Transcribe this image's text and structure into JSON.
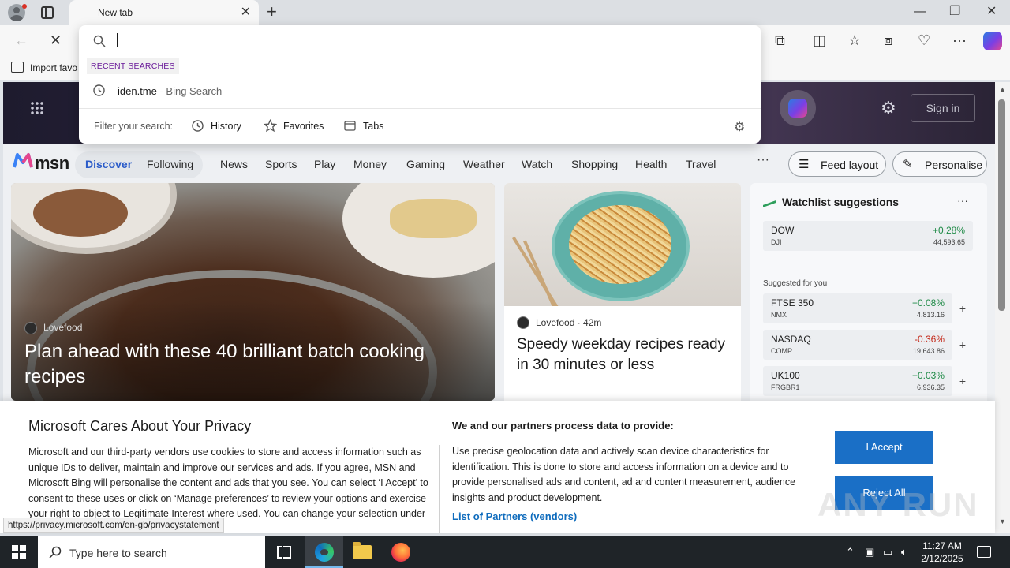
{
  "browser": {
    "tab_title": "New tab",
    "favorites_bar_label": "Import favo"
  },
  "address_dropdown": {
    "input_value": "",
    "recent_label": "RECENT SEARCHES",
    "recent_items": [
      {
        "query": "iden.tme",
        "source": " - Bing Search"
      }
    ],
    "filter_label": "Filter your search:",
    "filters": [
      "History",
      "Favorites",
      "Tabs"
    ]
  },
  "msn": {
    "logo_text": "msn",
    "sign_in": "Sign in",
    "nav": {
      "active": "Discover",
      "items": [
        "Discover",
        "Following",
        "News",
        "Sports",
        "Play",
        "Money",
        "Gaming",
        "Weather",
        "Watch",
        "Shopping",
        "Health",
        "Travel"
      ],
      "more": "···",
      "feed_layout": "Feed layout",
      "personalise": "Personalise"
    },
    "main_card": {
      "source": "Lovefood",
      "title": "Plan ahead with these 40 brilliant batch cooking recipes"
    },
    "side_card": {
      "source": "Lovefood",
      "age": " · 42m",
      "title": "Speedy weekday recipes ready in 30 minutes or less"
    },
    "watchlist": {
      "title": "Watchlist suggestions",
      "more": "···",
      "pinned": [
        {
          "name": "DOW",
          "exchange": "DJI",
          "change": "+0.28%",
          "value": "44,593.65",
          "direction": "up"
        }
      ],
      "suggested_label": "Suggested for you",
      "suggested": [
        {
          "name": "FTSE 350",
          "exchange": "NMX",
          "change": "+0.08%",
          "value": "4,813.16",
          "direction": "up"
        },
        {
          "name": "NASDAQ",
          "exchange": "COMP",
          "change": "-0.36%",
          "value": "19,643.86",
          "direction": "down"
        },
        {
          "name": "UK100",
          "exchange": "FRGBR1",
          "change": "+0.03%",
          "value": "6,936.35",
          "direction": "up"
        }
      ]
    }
  },
  "privacy": {
    "title": "Microsoft Cares About Your Privacy",
    "body": "Microsoft and our third-party vendors use cookies to store and access information such as unique IDs to deliver, maintain and improve our services and ads. If you agree, MSN and Microsoft Bing will personalise the content and ads that you see. You can select ‘I Accept’ to consent to these uses or click on ‘Manage preferences’ to review your options and exercise your right to object to Legitimate Interest where used. You can change your selection under ‘Manage Preferences’ at the bottom of",
    "subtitle": "We and our partners process data to provide:",
    "body2": "Use precise geolocation data and actively scan device characteristics for identification. This is done to store and access information on a device and to provide personalised ads and content, ad and content measurement, audience insights and product development.",
    "partners_link": "List of Partners (vendors)",
    "accept": "I Accept",
    "reject": "Reject All"
  },
  "status_url": "https://privacy.microsoft.com/en-gb/privacystatement",
  "watermark": "ANY RUN",
  "taskbar": {
    "search_placeholder": "Type here to search",
    "time": "11:27 AM",
    "date": "2/12/2025"
  },
  "colors": {
    "accent": "#1a6fc6",
    "link": "#0f6cbd",
    "up": "#1e8a46",
    "down": "#c42b1c",
    "recent_label": "#6a1b9a"
  }
}
